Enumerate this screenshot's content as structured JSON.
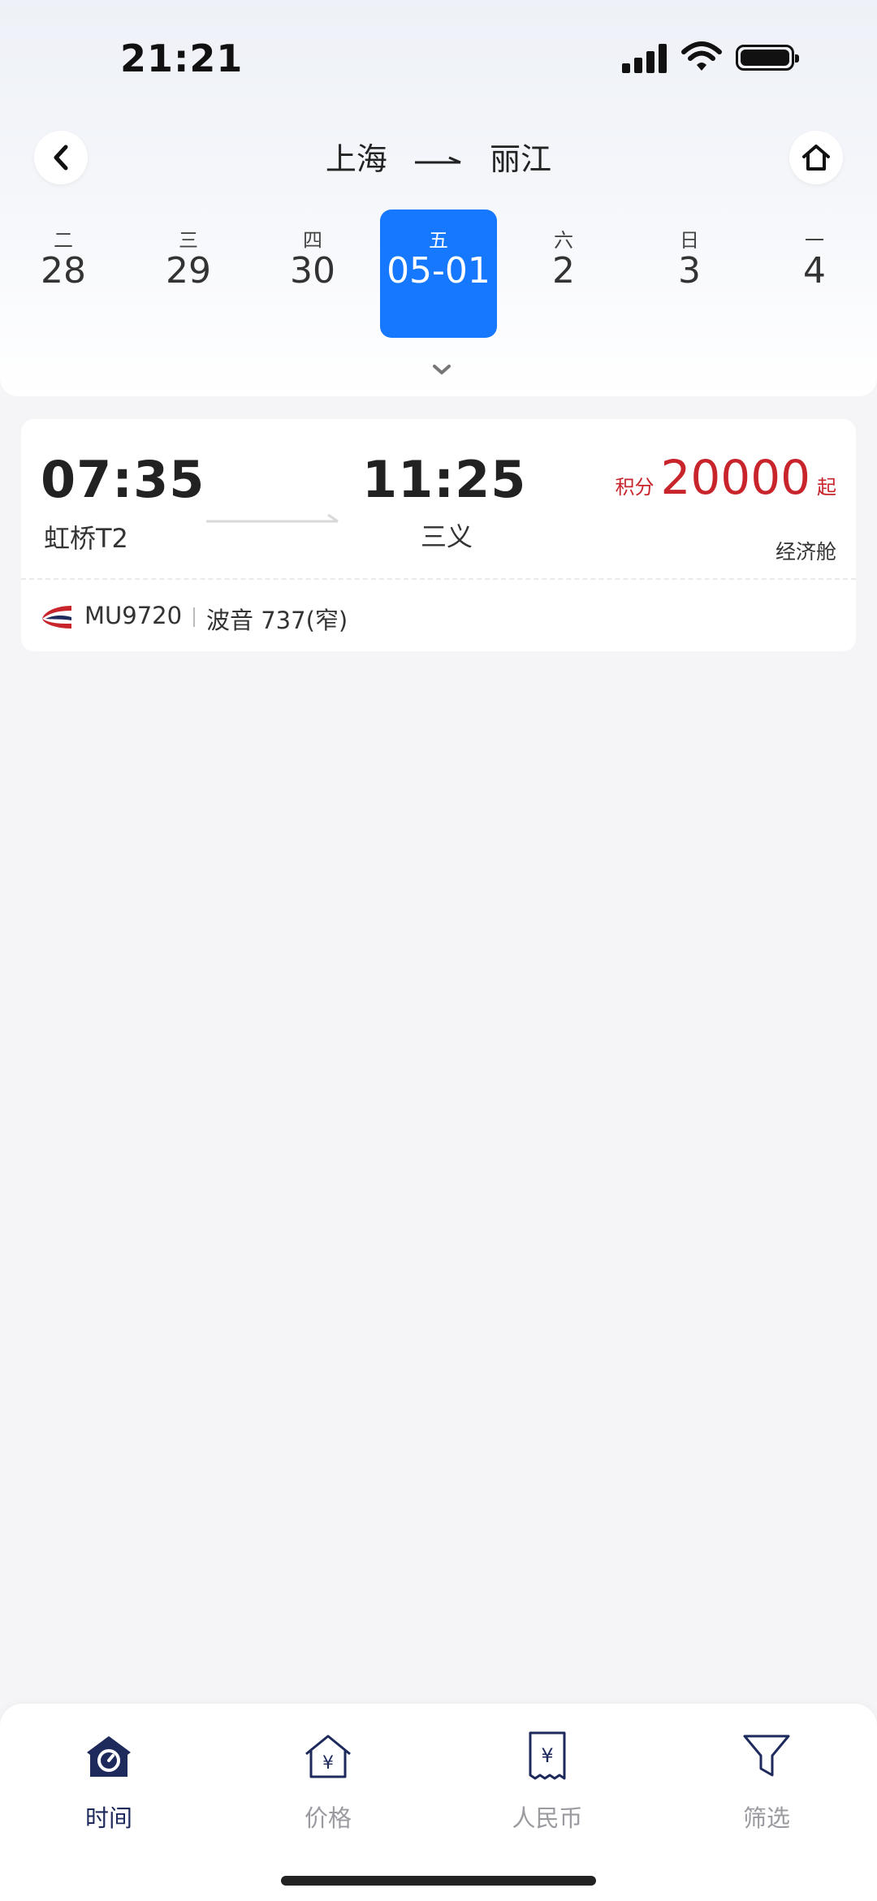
{
  "status": {
    "time": "21:21"
  },
  "header": {
    "origin": "上海",
    "destination": "丽江"
  },
  "dates": [
    {
      "weekday": "二",
      "day": "28",
      "selected": false
    },
    {
      "weekday": "三",
      "day": "29",
      "selected": false
    },
    {
      "weekday": "四",
      "day": "30",
      "selected": false
    },
    {
      "weekday": "五",
      "day": "05-01",
      "selected": true
    },
    {
      "weekday": "六",
      "day": "2",
      "selected": false
    },
    {
      "weekday": "日",
      "day": "3",
      "selected": false
    },
    {
      "weekday": "一",
      "day": "4",
      "selected": false
    }
  ],
  "flight": {
    "dep_time": "07:35",
    "arr_time": "11:25",
    "dep_airport": "虹桥T2",
    "arr_airport": "三义",
    "price_prefix": "积分",
    "price": "20000",
    "price_suffix": "起",
    "cabin": "经济舱",
    "flight_no": "MU9720",
    "aircraft": "波音 737(窄)"
  },
  "tabs": [
    {
      "label": "时间",
      "icon": "time-icon",
      "active": true
    },
    {
      "label": "价格",
      "icon": "price-icon",
      "active": false
    },
    {
      "label": "人民币",
      "icon": "rmb-icon",
      "active": false
    },
    {
      "label": "筛选",
      "icon": "filter-icon",
      "active": false
    }
  ],
  "colors": {
    "accent": "#1677ff",
    "price": "#c8242b",
    "tab_active": "#1d2a5b",
    "tab_inactive": "#9a9aa0"
  }
}
